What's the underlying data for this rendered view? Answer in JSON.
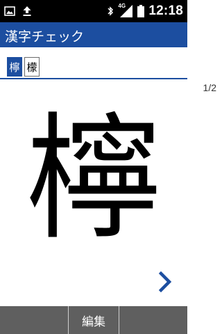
{
  "status_bar": {
    "time": "12:18",
    "network": "4G",
    "icons": [
      "gallery-icon",
      "upload-icon",
      "bluetooth-icon",
      "signal-icon",
      "battery-icon"
    ]
  },
  "header": {
    "title": "漢字チェック"
  },
  "tabs": [
    {
      "label": "檸",
      "selected": true
    },
    {
      "label": "檬",
      "selected": false
    }
  ],
  "page_indicator": "1/2",
  "main_kanji": "檸",
  "bottom_bar": {
    "edit_label": "編集"
  },
  "colors": {
    "accent": "#1c4ea0",
    "bottom_bar": "#5f5f5f",
    "status_bar": "#000000"
  }
}
